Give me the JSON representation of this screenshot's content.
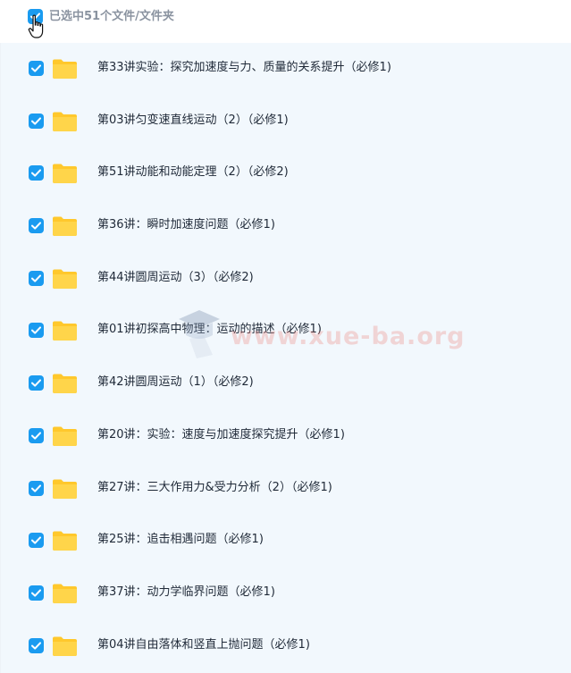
{
  "header": {
    "selected_label": "已选中51个文件/文件夹"
  },
  "items": [
    {
      "name": "第33讲实验：探究加速度与力、质量的关系提升（必修1)"
    },
    {
      "name": "第03讲匀变速直线运动（2）（必修1)"
    },
    {
      "name": "第51讲动能和动能定理（2）（必修2)"
    },
    {
      "name": "第36讲：瞬时加速度问题（必修1)"
    },
    {
      "name": "第44讲圆周运动（3）（必修2)"
    },
    {
      "name": "第01讲初探高中物理：运动的描述（必修1)"
    },
    {
      "name": "第42讲圆周运动（1）（必修2)"
    },
    {
      "name": "第20讲：实验：速度与加速度探究提升（必修1)"
    },
    {
      "name": "第27讲：三大作用力&受力分析（2）（必修1)"
    },
    {
      "name": "第25讲：追击相遇问题（必修1)"
    },
    {
      "name": "第37讲：动力学临界问题（必修1)"
    },
    {
      "name": "第04讲自由落体和竖直上抛问题（必修1)"
    }
  ],
  "watermark": {
    "text": "www.xue-ba.org"
  },
  "colors": {
    "checkbox": "#1a9bf0",
    "folder": "#ffc82c",
    "list_bg": "#f2f8fd"
  },
  "icons": {
    "checkbox": "check-icon",
    "folder": "folder-icon",
    "cursor": "hand-pointer-icon",
    "watermark_logo": "graduation-cap-icon"
  }
}
